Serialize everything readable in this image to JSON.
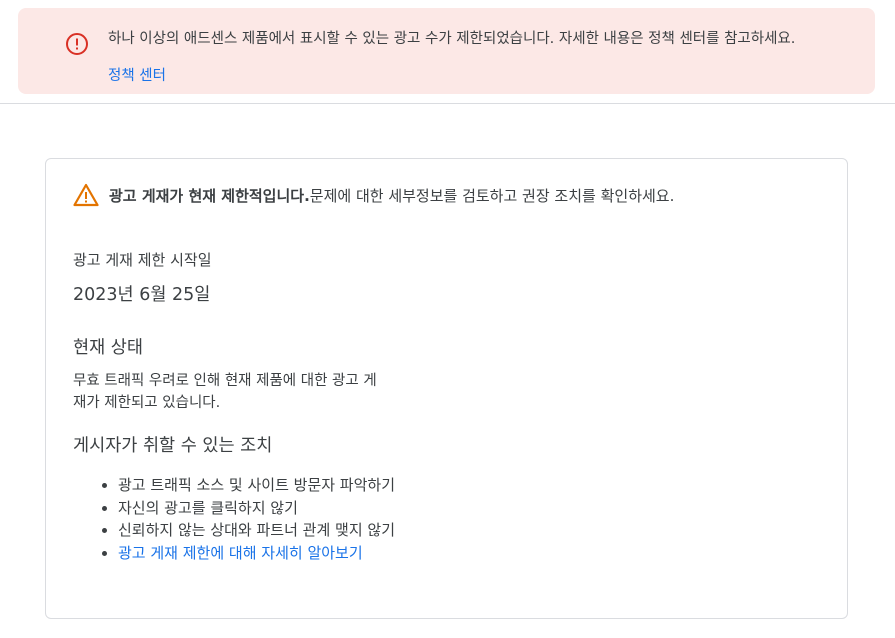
{
  "banner": {
    "message": "하나 이상의 애드센스 제품에서 표시할 수 있는 광고 수가 제한되었습니다. 자세한 내용은 정책 센터를 참고하세요.",
    "link_label": "정책 센터",
    "icon": "error-circle-icon",
    "bg_color": "#fce8e6",
    "icon_color": "#d93025"
  },
  "card": {
    "warning_icon": "warning-triangle-icon",
    "warning_color": "#e37400",
    "headline_bold": "광고 게재가 현재 제한적입니다.",
    "headline_rest": " 문제에 대한 세부정보를 검토하고 권장 조치를 확인하세요.",
    "start_label": "광고 게재 제한 시작일",
    "start_date": "2023년 6월 25일",
    "status_heading": "현재 상태",
    "status_line1": "무효 트래픽 우려로 인해 현재 제품에 대한 광고 게",
    "status_line2": "재가 제한되고 있습니다.",
    "actions_heading": "게시자가 취할 수 있는 조치",
    "actions": [
      "광고 트래픽 소스 및 사이트 방문자 파악하기",
      "자신의 광고를 클릭하지 않기",
      "신뢰하지 않는 상대와 파트너 관계 맺지 않기"
    ],
    "learn_more_link": "광고 게재 제한에 대해 자세히 알아보기",
    "link_color": "#1a73e8"
  }
}
